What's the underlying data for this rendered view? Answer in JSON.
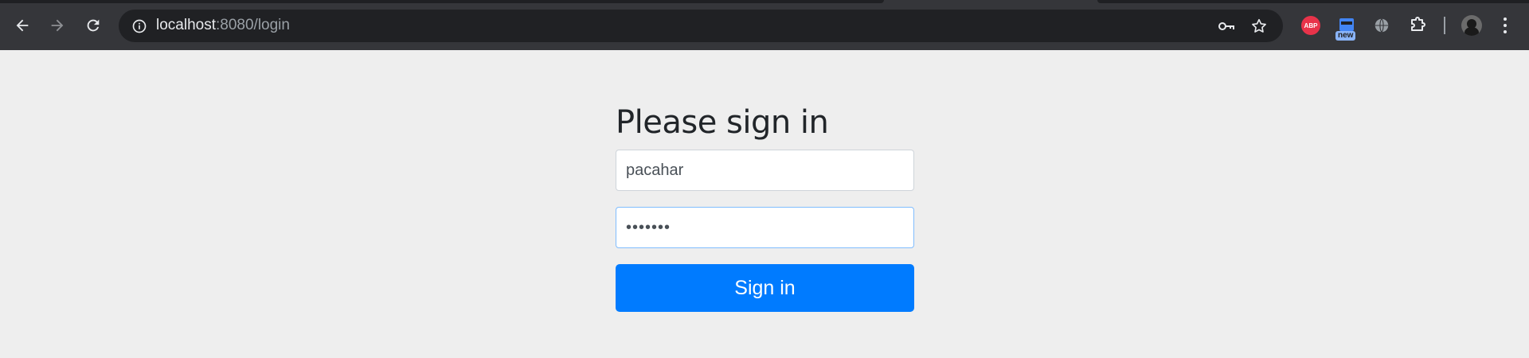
{
  "browser": {
    "url_host": "localhost",
    "url_rest": ":8080/login",
    "extensions": {
      "abp_label": "ABP",
      "new_badge": "new"
    }
  },
  "form": {
    "heading": "Please sign in",
    "username_value": "pacahar",
    "password_value": "•••••••",
    "submit_label": "Sign in"
  },
  "colors": {
    "primary": "#007bff",
    "page_bg": "#eeeeee",
    "toolbar_bg": "#35363a",
    "omnibox_bg": "#202124",
    "focus_border": "#80bdff"
  }
}
